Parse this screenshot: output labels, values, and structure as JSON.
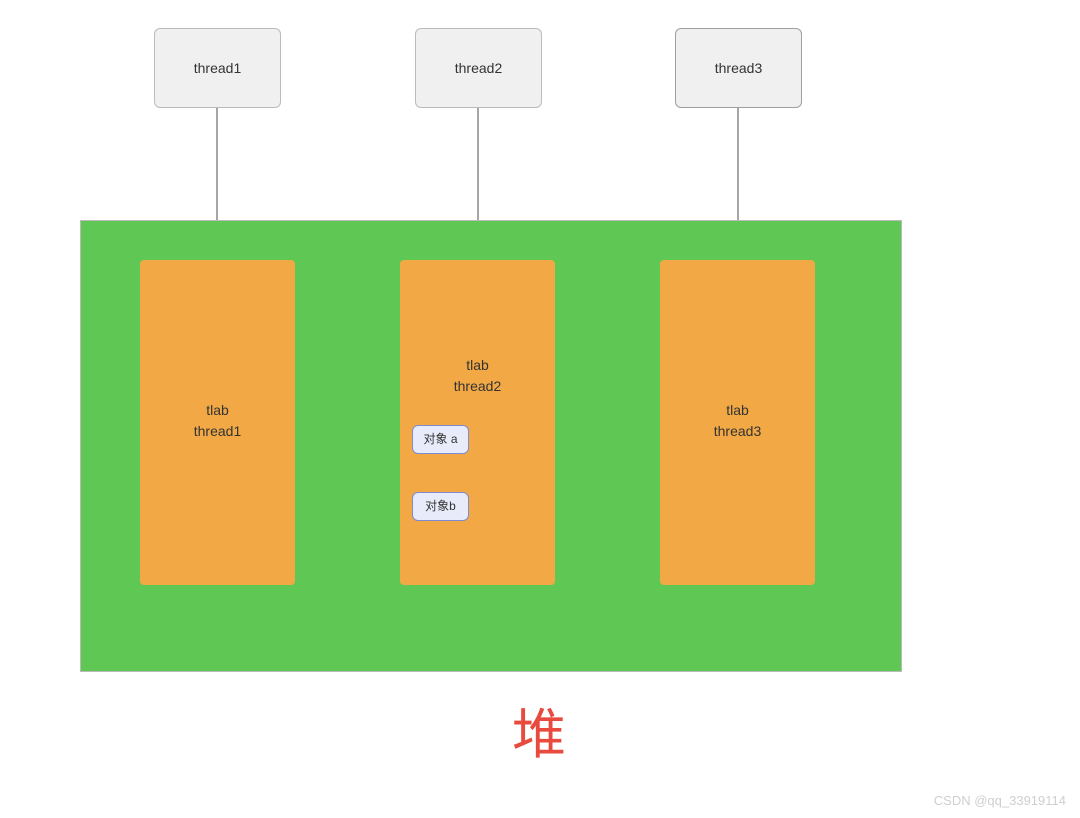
{
  "chart_data": {
    "type": "diagram",
    "threads": [
      {
        "id": "thread1",
        "tlab_label": "tlab\nthread1",
        "objects": []
      },
      {
        "id": "thread2",
        "tlab_label": "tlab\nthread2",
        "objects": [
          "对象 a",
          "对象b"
        ]
      },
      {
        "id": "thread3",
        "tlab_label": "tlab\nthread3",
        "objects": []
      }
    ],
    "heap_title": "堆"
  },
  "threads": {
    "t1": {
      "label": "thread1"
    },
    "t2": {
      "label": "thread2"
    },
    "t3": {
      "label": "thread3"
    }
  },
  "tlabs": {
    "t1": {
      "line1": "tlab",
      "line2": "thread1"
    },
    "t2": {
      "line1": "tlab",
      "line2": "thread2"
    },
    "t3": {
      "line1": "tlab",
      "line2": "thread3"
    }
  },
  "objects": {
    "a": "对象 a",
    "b": "对象b"
  },
  "heap_title": "堆",
  "watermark": "CSDN @qq_33919114"
}
